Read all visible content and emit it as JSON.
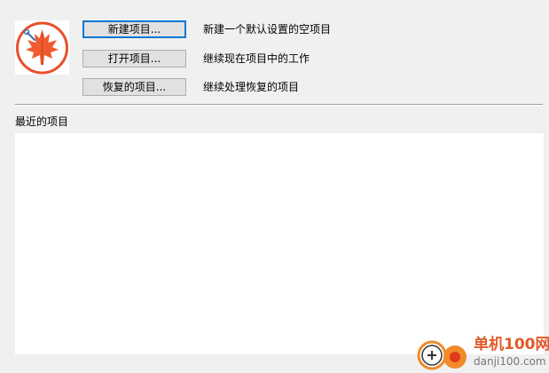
{
  "actions": [
    {
      "button_label": "新建项目...",
      "description": "新建一个默认设置的空项目"
    },
    {
      "button_label": "打开项目...",
      "description": "继续现在项目中的工作"
    },
    {
      "button_label": "恢复的项目...",
      "description": "继续处理恢复的项目"
    }
  ],
  "recent": {
    "label": "最近的项目",
    "items": []
  },
  "watermark": {
    "title": "单机100网",
    "url": "danji100.com"
  },
  "icons": {
    "logo": "maple-leaf-icon"
  },
  "colors": {
    "logo_red": "#e8502c",
    "logo_orange": "#f47a36",
    "focus_border": "#0078d7",
    "watermark_orange": "#e05a2a"
  }
}
